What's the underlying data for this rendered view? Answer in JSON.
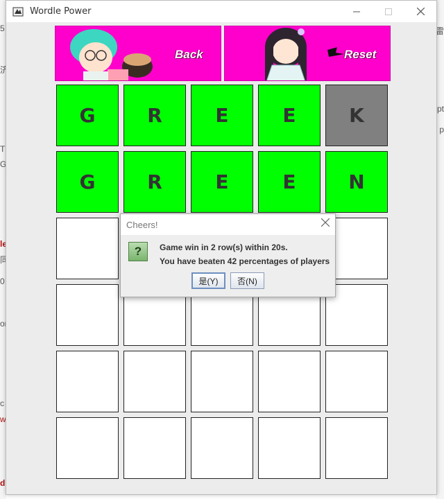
{
  "window": {
    "title": "Wordle Power"
  },
  "banner": {
    "back_label": "Back",
    "reset_label": "Reset"
  },
  "board": {
    "rows": [
      [
        {
          "letter": "G",
          "state": "green"
        },
        {
          "letter": "R",
          "state": "green"
        },
        {
          "letter": "E",
          "state": "green"
        },
        {
          "letter": "E",
          "state": "green"
        },
        {
          "letter": "K",
          "state": "gray"
        }
      ],
      [
        {
          "letter": "G",
          "state": "green"
        },
        {
          "letter": "R",
          "state": "green"
        },
        {
          "letter": "E",
          "state": "green"
        },
        {
          "letter": "E",
          "state": "green"
        },
        {
          "letter": "N",
          "state": "green"
        }
      ],
      [
        {
          "letter": "",
          "state": "empty"
        },
        {
          "letter": "",
          "state": "empty"
        },
        {
          "letter": "",
          "state": "empty"
        },
        {
          "letter": "",
          "state": "empty"
        },
        {
          "letter": "",
          "state": "empty"
        }
      ],
      [
        {
          "letter": "",
          "state": "empty"
        },
        {
          "letter": "",
          "state": "empty"
        },
        {
          "letter": "",
          "state": "empty"
        },
        {
          "letter": "",
          "state": "empty"
        },
        {
          "letter": "",
          "state": "empty"
        }
      ],
      [
        {
          "letter": "",
          "state": "empty"
        },
        {
          "letter": "",
          "state": "empty"
        },
        {
          "letter": "",
          "state": "empty"
        },
        {
          "letter": "",
          "state": "empty"
        },
        {
          "letter": "",
          "state": "empty"
        }
      ],
      [
        {
          "letter": "",
          "state": "empty"
        },
        {
          "letter": "",
          "state": "empty"
        },
        {
          "letter": "",
          "state": "empty"
        },
        {
          "letter": "",
          "state": "empty"
        },
        {
          "letter": "",
          "state": "empty"
        }
      ]
    ]
  },
  "dialog": {
    "title": "Cheers!",
    "message_line1": "Game win in 2 row(s) within 20s.",
    "message_line2": "You have beaten 42 percentages of players",
    "yes_label": "是(Y)",
    "no_label": "否(N)"
  },
  "background_fragments": [
    "5",
    "济",
    "T",
    "G",
    "le",
    "同",
    "0",
    "or",
    "c",
    "wo",
    "d",
    "雷",
    "pt",
    "p"
  ],
  "colors": {
    "banner": "#ff00cc",
    "correct": "#00ff00",
    "absent": "#808080",
    "empty": "#ffffff"
  }
}
